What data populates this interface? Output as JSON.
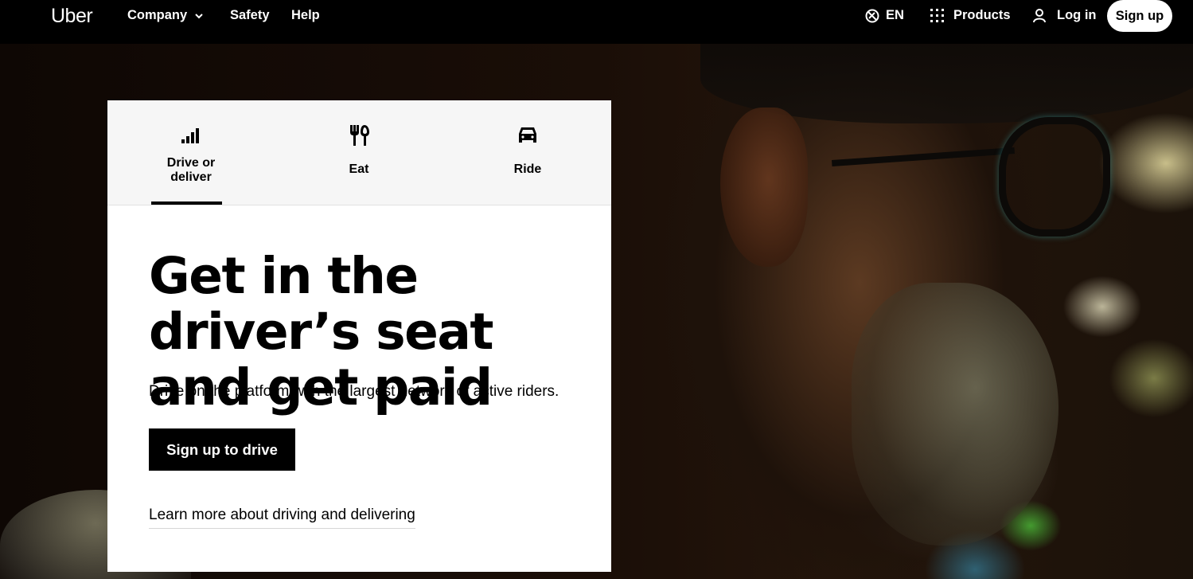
{
  "nav": {
    "logo": "Uber",
    "company": "Company",
    "safety": "Safety",
    "help": "Help",
    "language": "EN",
    "products": "Products",
    "login": "Log in",
    "signup": "Sign up"
  },
  "tabs": [
    {
      "label": "Drive or deliver",
      "icon": "signal-bars-icon",
      "active": true
    },
    {
      "label": "Eat",
      "icon": "fork-knife-icon",
      "active": false
    },
    {
      "label": "Ride",
      "icon": "car-icon",
      "active": false
    }
  ],
  "hero": {
    "headline": "Get in the driver’s seat and get paid",
    "subtext": "Drive on the platform with the largest network of active riders.",
    "cta": "Sign up to drive",
    "learn_more": "Learn more about driving and delivering"
  },
  "colors": {
    "nav_bg": "#000000",
    "card_bg": "#ffffff",
    "tabs_bg": "#f6f6f6",
    "button_bg": "#000000"
  }
}
